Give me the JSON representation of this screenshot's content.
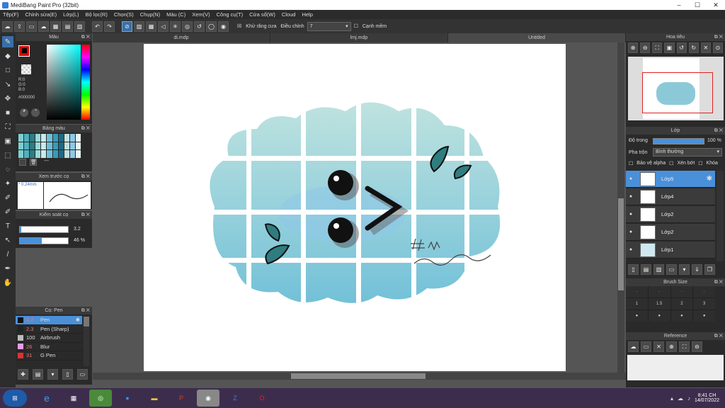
{
  "window": {
    "title": "MediBang Paint Pro (32bit)"
  },
  "menu": [
    "Tệp(F)",
    "Chỉnh sửa(E)",
    "Lớp(L)",
    "Bộ lọc(R)",
    "Chọn(S)",
    "Chụp(N)",
    "Màu (C)",
    "Xem(V)",
    "Công cụ(T)",
    "Cửa sổ(W)",
    "Cloud",
    "Help"
  ],
  "toolbar": {
    "antialias": "Khử răng cưa",
    "adjust": "Điều chỉnh",
    "adjust_value": "7",
    "soft_edge": "Cạnh mềm"
  },
  "tabs": [
    "di.mdp",
    "lmj.mdp",
    "Untitled"
  ],
  "color_panel": {
    "title": "Màu",
    "r": "R:0",
    "g": "G:0",
    "b": "B:0",
    "hex": "#000000"
  },
  "palette_panel": {
    "title": "Bảng màu",
    "dash": "---"
  },
  "preview_panel": {
    "title": "Xem trước cọ",
    "size": "* 0.24mm"
  },
  "brush_control": {
    "title": "Kiểm soát cọ",
    "size": "3.2",
    "opacity": "46 %",
    "opacity_fraction": 0.46
  },
  "brush_panel": {
    "title": "Cọ: Pen",
    "items": [
      {
        "size": "3.2",
        "name": "Pen",
        "color": "#111111"
      },
      {
        "size": "2.3",
        "name": "Pen (Sharp)",
        "color": "#222222"
      },
      {
        "size": "100",
        "name": "Airbrush",
        "color": "#bbbbbb"
      },
      {
        "size": "26",
        "name": "Blur",
        "color": "#ee99ee"
      },
      {
        "size": "31",
        "name": "G Pen",
        "color": "#e03030"
      }
    ]
  },
  "navigator": {
    "title": "Hoa tiêu"
  },
  "layer_panel": {
    "title": "Lớp",
    "opacity_label": "Độ trong",
    "opacity": "100 %",
    "opacity_fraction": 1.0,
    "blend_label": "Pha trộn",
    "blend": "Bình thường",
    "protect_alpha": "Bảo vệ alpha",
    "clip": "Xén bớt",
    "lock": "Khóa",
    "layers": [
      "Lớp5",
      "Lớp4",
      "Lớp2",
      "Lớp2",
      "Lớp1"
    ]
  },
  "brush_size_panel": {
    "title": "Brush Size",
    "labels": [
      "1",
      "1.5",
      "2",
      "3"
    ]
  },
  "reference_panel": {
    "title": "Reference"
  },
  "taskbar": {
    "time": "8:41 CH",
    "date": "14/07/2022"
  },
  "colors": {
    "accent": "#4a90d9",
    "cloud": "#7ec4d8"
  }
}
